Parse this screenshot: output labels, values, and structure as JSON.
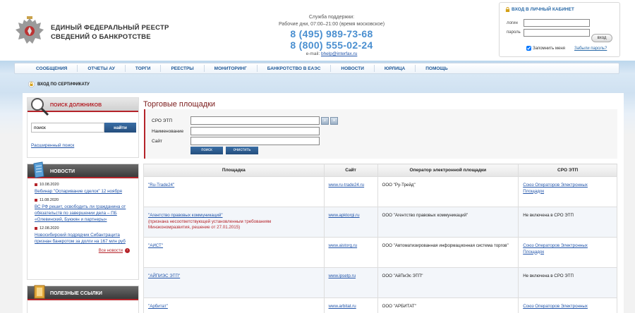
{
  "header": {
    "title_line1": "ЕДИНЫЙ ФЕДЕРАЛЬНЫЙ РЕЕСТР",
    "title_line2": "СВЕДЕНИЙ О БАНКРОТСТВЕ",
    "support_label": "Служба поддержки:",
    "support_hours": "Рабочие дни, 07:00–21:00 (время московское)",
    "phone1": "8 (495) 989-73-68",
    "phone2": "8 (800) 555-02-24",
    "email_label": "e-mail: ",
    "email": "bhelp@interfax.ru"
  },
  "login": {
    "title": "ВХОД В ЛИЧНЫЙ КАБИНЕТ",
    "login_label": "логин",
    "password_label": "пароль",
    "submit_label": "вход",
    "remember_label": "Запомнить меня",
    "forgot_label": "Забыли пароль?",
    "remember_checked": true
  },
  "nav": {
    "items": [
      "СООБЩЕНИЯ",
      "ОТЧЕТЫ АУ",
      "ТОРГИ",
      "РЕЕСТРЫ",
      "МОНИТОРИНГ",
      "БАНКРОТСТВО В ЕАЭС",
      "НОВОСТИ",
      "ЮРЛИЦА",
      "ПОМОЩЬ"
    ],
    "cert_login": "ВХОД ПО СЕРТИФИКАТУ"
  },
  "sidebar": {
    "search_title": "ПОИСК ДОЛЖНИКОВ",
    "search_value": "поиск",
    "search_button": "найти",
    "advanced_search": "Расширенный поиск",
    "news_title": "НОВОСТИ",
    "news": [
      {
        "date": "10.08.2020",
        "text1": "Вебинар \"Оспаривание сделок\" 12 ноября",
        "text2": "",
        "text3": ""
      },
      {
        "date": "11.08.2020",
        "text1": "ВС РФ решит, освободить ли гражданина от",
        "text2": "обязательств по завершении дела – ПБ",
        "text3": "«Олевинский, Буюкян и партнеры»"
      },
      {
        "date": "12.08.2020",
        "text1": "Новосибирский подрядчик Сибантрацита",
        "text2": "признан банкротом за долги на 167 млн руб",
        "text3": ""
      }
    ],
    "all_news": "Все новости",
    "links_title": "ПОЛЕЗНЫЕ ССЫЛКИ"
  },
  "main": {
    "page_title": "Торговые площадки",
    "filter": {
      "sro_label": "СРО ЭТП",
      "name_label": "Наименование",
      "site_label": "Сайт",
      "search_button": "поиск",
      "clear_button": "очистить"
    },
    "table": {
      "headers": [
        "Площадка",
        "Сайт",
        "Оператор электронной площадки",
        "СРО ЭТП"
      ],
      "rows": [
        {
          "name": "\"Ru-Trade24\"",
          "note1": "",
          "note2": "",
          "site": "www.ru-trade24.ru",
          "operator": "ООО \"Ру-Трейд\"",
          "sro1": "Союз Операторов Электронных",
          "sro2": "Площадок",
          "sro_link": true
        },
        {
          "name": "\"Агентство правовых коммуникаций\"",
          "note1": "(признана несоответствующей установленным требованиям",
          "note2": "Минэкономразвития, решение от 27.01.2015)",
          "site": "www.apktorgi.ru",
          "operator": "ООО \"Агентство правовых коммуникаций\"",
          "sro1": "Не включена в СРО ЭТП",
          "sro2": "",
          "sro_link": false
        },
        {
          "name": "\"АИСТ\"",
          "note1": "",
          "note2": "",
          "site": "www.aistorg.ru",
          "operator": "ООО \"Автоматизированная информационная система торгов\"",
          "sro1": "Союз Операторов Электронных",
          "sro2": "Площадок",
          "sro_link": true
        },
        {
          "name": "\"АЙПИЭС ЭТП\"",
          "note1": "",
          "note2": "",
          "site": "www.ipsetp.ru",
          "operator": "ООО \"АйПиЭс ЭТП\"",
          "sro1": "Не включена в СРО ЭТП",
          "sro2": "",
          "sro_link": false
        },
        {
          "name": "\"Арбитат\"",
          "note1": "",
          "note2": "",
          "site": "www.arbitat.ru",
          "operator": "ООО \"АРБИТАТ\"",
          "sro1": "Союз Операторов Электронных",
          "sro2": "",
          "sro_link": true
        }
      ]
    }
  }
}
